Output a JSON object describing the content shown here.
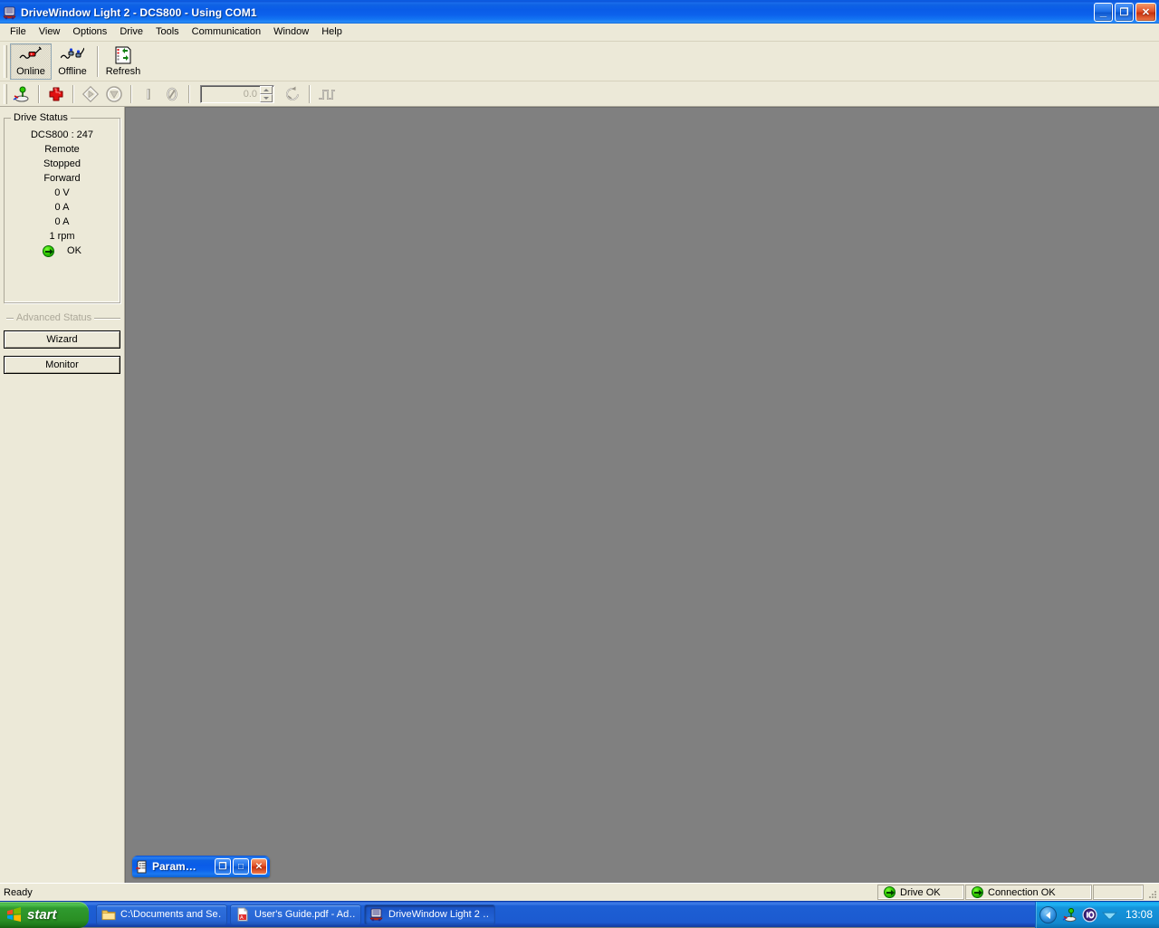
{
  "window": {
    "title": "DriveWindow Light 2 - DCS800 - Using COM1",
    "icon": "drive-app-icon",
    "controls": {
      "minimize": "_",
      "restore": "❐",
      "close": "✕"
    }
  },
  "menu": {
    "items": [
      {
        "label": "File"
      },
      {
        "label": "View"
      },
      {
        "label": "Options"
      },
      {
        "label": "Drive"
      },
      {
        "label": "Tools"
      },
      {
        "label": "Communication"
      },
      {
        "label": "Window"
      },
      {
        "label": "Help"
      }
    ]
  },
  "toolbar_main": {
    "buttons": [
      {
        "label": "Online",
        "icon": "online-cable-icon",
        "pressed": true
      },
      {
        "label": "Offline",
        "icon": "offline-cable-icon",
        "pressed": false
      },
      {
        "label": "Refresh",
        "icon": "refresh-list-icon",
        "pressed": false
      }
    ]
  },
  "toolbar_second": {
    "buttons": [
      {
        "name": "connect-drive",
        "icon": "drive-connect-icon",
        "enabled": true
      },
      {
        "name": "add-item",
        "icon": "red-cross-add-icon",
        "enabled": true
      },
      {
        "name": "start-drive",
        "icon": "start-diamond-icon",
        "enabled": false
      },
      {
        "name": "stop-drive",
        "icon": "stop-sign-icon",
        "enabled": false
      },
      {
        "name": "on-toggle",
        "icon": "power-on-icon",
        "enabled": false
      },
      {
        "name": "off-toggle",
        "icon": "power-off-icon",
        "enabled": false
      },
      {
        "name": "reset-reference",
        "icon": "reset-arrow-icon",
        "enabled": false
      },
      {
        "name": "signal-step",
        "icon": "step-signal-icon",
        "enabled": false
      }
    ],
    "reference_spinner": {
      "value": "0.0",
      "enabled": false
    }
  },
  "sidebar": {
    "drive_status": {
      "title": "Drive Status",
      "lines": [
        {
          "text": "DCS800 : 247"
        },
        {
          "text": "Remote"
        },
        {
          "text": "Stopped"
        },
        {
          "text": "Forward"
        },
        {
          "text": "0 V"
        },
        {
          "text": "0 A"
        },
        {
          "text": "0 A"
        },
        {
          "text": "1 rpm"
        }
      ],
      "fault_line": {
        "icon": "green-arrow-icon",
        "text": "OK"
      }
    },
    "advanced_status": {
      "title": "Advanced Status",
      "enabled": false
    },
    "buttons": [
      {
        "label": "Wizard"
      },
      {
        "label": "Monitor"
      }
    ]
  },
  "mdi_child": {
    "title": "Param…",
    "icon": "parameter-window-icon",
    "controls": {
      "restore": "❐",
      "maximize": "□",
      "close": "✕"
    }
  },
  "statusbar": {
    "message": "Ready",
    "panels": [
      {
        "icon": "green-arrow-icon",
        "label": "Drive OK"
      },
      {
        "icon": "green-arrow-icon",
        "label": "Connection OK"
      },
      {
        "icon": "",
        "label": ""
      }
    ]
  },
  "taskbar": {
    "start_label": "start",
    "start_icon": "windows-flag-icon",
    "tasks": [
      {
        "label": "C:\\Documents and Se…",
        "icon": "folder-icon",
        "active": false
      },
      {
        "label": "User's Guide.pdf - Ad…",
        "icon": "pdf-icon",
        "active": false
      },
      {
        "label": "DriveWindow Light 2 …",
        "icon": "drive-app-icon",
        "active": true
      }
    ],
    "tray": {
      "chevron": "show-hidden-icons-icon",
      "icons": [
        "network-drive-icon",
        "io-device-icon",
        "volume-icon"
      ],
      "clock": "13:08"
    }
  },
  "colors": {
    "titlebar_blue": "#0a5ce8",
    "face": "#ece9d8",
    "workspace_gray": "#808080",
    "status_green": "#36cc00",
    "taskbar_blue": "#1d5fd4",
    "start_green": "#2f9a2f"
  }
}
